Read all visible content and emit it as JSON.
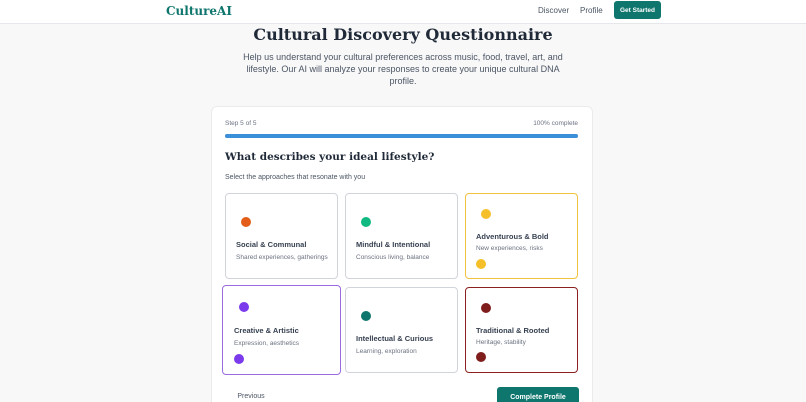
{
  "nav": {
    "logo": "CultureAI",
    "links": [
      "Discover",
      "Profile"
    ],
    "cta": "Get Started",
    "brand_color": "#0f766e"
  },
  "header": {
    "title": "Cultural Discovery Questionnaire",
    "description": "Help us understand your cultural preferences across music, food, travel, art, and lifestyle. Our AI will analyze your responses to create your unique cultural DNA profile."
  },
  "progress": {
    "step_label": "Step 5 of 5",
    "percent_label": "100% complete",
    "percent": 100,
    "bar_color": "#3b8fd9"
  },
  "question": {
    "title": "What describes your ideal lifestyle?",
    "subtitle": "Select the approaches that resonate with you"
  },
  "options": [
    {
      "title": "Social & Communal",
      "desc": "Shared experiences, gatherings",
      "color": "#e35d19",
      "selected": false
    },
    {
      "title": "Mindful & Intentional",
      "desc": "Conscious living, balance",
      "color": "#10b981",
      "selected": false
    },
    {
      "title": "Adventurous & Bold",
      "desc": "New experiences, risks",
      "color": "#f5bf2a",
      "selected": true
    },
    {
      "title": "Creative & Artistic",
      "desc": "Expression, aesthetics",
      "color": "#7c3aed",
      "selected": true
    },
    {
      "title": "Intellectual & Curious",
      "desc": "Learning, exploration",
      "color": "#0f766e",
      "selected": false
    },
    {
      "title": "Traditional & Rooted",
      "desc": "Heritage, stability",
      "color": "#7f1d1d",
      "selected": true
    }
  ],
  "footer": {
    "previous": "Previous",
    "complete": "Complete Profile"
  }
}
